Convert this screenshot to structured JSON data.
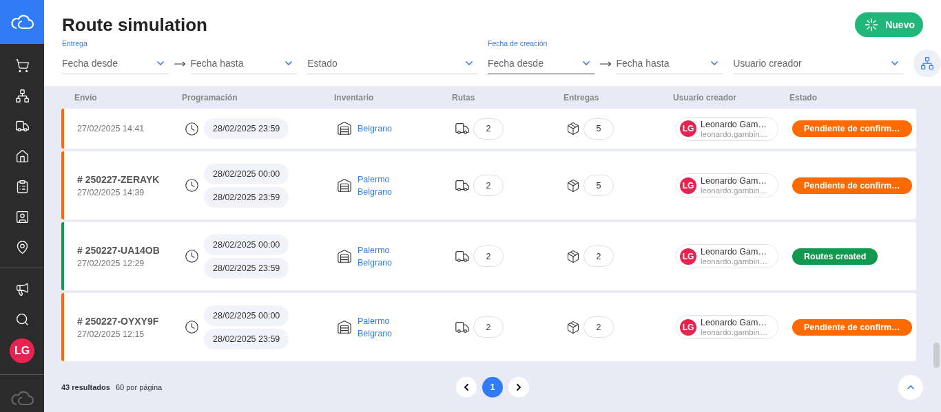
{
  "header": {
    "title": "Route simulation",
    "new_button": "Nuevo"
  },
  "filters": [
    {
      "kind": "date_from",
      "label": "Entrega",
      "placeholder": "Fecha desde",
      "active": false
    },
    {
      "kind": "date_to",
      "placeholder": "Fecha hasta",
      "active": false
    },
    {
      "kind": "select",
      "placeholder": "Estado",
      "active": false
    },
    {
      "kind": "date_from",
      "label": "Fecha de creación",
      "placeholder": "Fecha desde",
      "active": true
    },
    {
      "kind": "date_to",
      "placeholder": "Fecha hasta",
      "active": false
    },
    {
      "kind": "select",
      "placeholder": "Usuario creador",
      "active": false
    }
  ],
  "table": {
    "columns": [
      "Envío",
      "Programación",
      "Inventario",
      "Rutas",
      "Entregas",
      "Usuario creador",
      "Estado"
    ],
    "rows": [
      {
        "created": "27/02/2025 14:41",
        "schedule": [
          "28/02/2025 23:59"
        ],
        "inventory": [
          "Belgrano"
        ],
        "routes": "2",
        "deliveries": "5",
        "user": {
          "initials": "LG",
          "name": "Leonardo Gam…",
          "email": "leonardo.gambin…"
        },
        "status": {
          "label": "Pendiente de confirm…",
          "color": "#ff6a00"
        }
      },
      {
        "id": "# 250227-ZERAYK",
        "created": "27/02/2025 14:39",
        "schedule": [
          "28/02/2025 00:00",
          "28/02/2025 23:59"
        ],
        "inventory": [
          "Palermo",
          "Belgrano"
        ],
        "routes": "2",
        "deliveries": "5",
        "user": {
          "initials": "LG",
          "name": "Leonardo Gam…",
          "email": "leonardo.gambin…"
        },
        "status": {
          "label": "Pendiente de confirm…",
          "color": "#ff6a00"
        }
      },
      {
        "id": "# 250227-UA14OB",
        "created": "27/02/2025 12:29",
        "schedule": [
          "28/02/2025 00:00",
          "28/02/2025 23:59"
        ],
        "inventory": [
          "Palermo",
          "Belgrano"
        ],
        "routes": "2",
        "deliveries": "2",
        "user": {
          "initials": "LG",
          "name": "Leonardo Gam…",
          "email": "leonardo.gambin…"
        },
        "status": {
          "label": "Routes created",
          "color": "#12994f"
        }
      },
      {
        "id": "# 250227-OYXY9F",
        "created": "27/02/2025 12:15",
        "schedule": [
          "28/02/2025 00:00",
          "28/02/2025 23:59"
        ],
        "inventory": [
          "Palermo",
          "Belgrano"
        ],
        "routes": "2",
        "deliveries": "2",
        "user": {
          "initials": "LG",
          "name": "Leonardo Gam…",
          "email": "leonardo.gambin…"
        },
        "status": {
          "label": "Pendiente de confirm…",
          "color": "#ff6a00"
        }
      }
    ]
  },
  "footer": {
    "results": "43 resultados",
    "per_page": "60 por página",
    "pages": [
      {
        "label": "1",
        "selected": true
      }
    ]
  },
  "sidebar": {
    "user_initials": "LG"
  }
}
